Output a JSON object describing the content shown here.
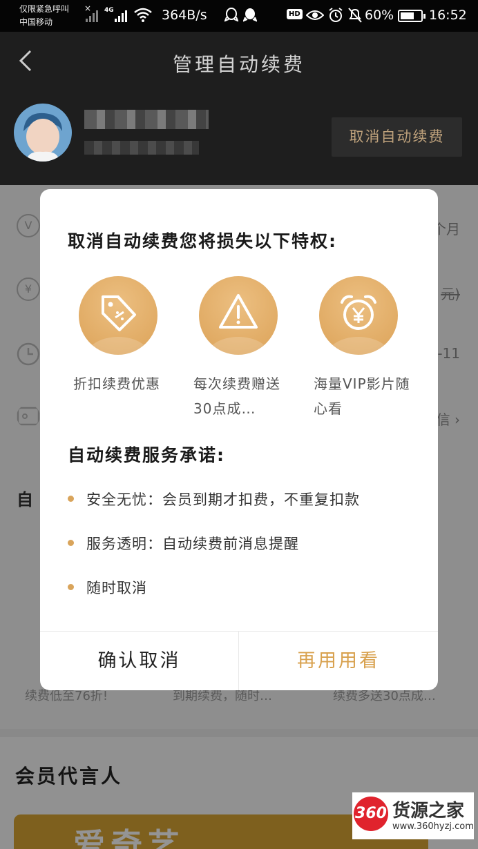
{
  "status_bar": {
    "carrier_line1": "仅限紧急呼叫",
    "carrier_line2": "中国移动",
    "network": "4G",
    "speed": "364B/s",
    "hd": "HD",
    "battery": "60%",
    "time": "16:52"
  },
  "header": {
    "title": "管理自动续费",
    "cancel_button": "取消自动续费"
  },
  "background": {
    "row_icons": [
      "V",
      "¥",
      "clock",
      "card"
    ],
    "row_right": [
      "个月",
      "元)",
      "-11",
      "信 ›"
    ],
    "section_title": "自",
    "perk_texts": [
      "续费低至76折!",
      "到期续费，随时…",
      "续费多送30点成…"
    ],
    "spokes_title": "会员代言人",
    "banner_text": "爱奇艺"
  },
  "dialog": {
    "heading": "取消自动续费您将损失以下特权:",
    "perks": [
      {
        "icon": "tag-icon",
        "label": "折扣续费优惠"
      },
      {
        "icon": "gift-alert-icon",
        "label": "每次续费赠送30点成…"
      },
      {
        "icon": "alarm-clock-yen-icon",
        "label": "海量VIP影片随心看"
      }
    ],
    "promise_title": "自动续费服务承诺:",
    "promises": [
      "安全无忧：会员到期才扣费，不重复扣款",
      "服务透明：自动续费前消息提醒",
      "随时取消"
    ],
    "confirm_button": "确认取消",
    "keep_button": "再用用看"
  },
  "watermark": {
    "logo": "360",
    "name": "货源之家",
    "url": "www.360hyzj.com"
  },
  "colors": {
    "accent_gold": "#d8a14e",
    "header_bg": "#1e1e1e",
    "perk_circle": "#dfa860"
  }
}
